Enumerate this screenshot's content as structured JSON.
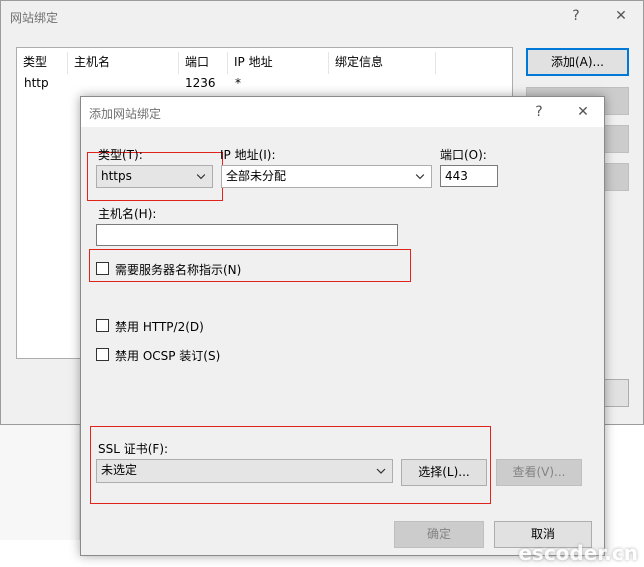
{
  "outer_window": {
    "title": "网站绑定",
    "help": "?",
    "close": "✕",
    "columns": [
      "类型",
      "主机名",
      "端口",
      "IP 地址",
      "绑定信息"
    ],
    "rows": [
      {
        "type": "http",
        "host": "",
        "port": "1236",
        "ip": "*",
        "info": ""
      }
    ],
    "buttons": {
      "add": "添加(A)..."
    }
  },
  "dialog": {
    "title": "添加网站绑定",
    "help": "?",
    "close": "✕",
    "type_label": "类型(T):",
    "type_value": "https",
    "ip_label": "IP 地址(I):",
    "ip_value": "全部未分配",
    "port_label": "端口(O):",
    "port_value": "443",
    "host_label": "主机名(H):",
    "host_value": "",
    "sni_label": "需要服务器名称指示(N)",
    "http2_label": "禁用 HTTP/2(D)",
    "ocsp_label": "禁用 OCSP 装订(S)",
    "ssl_label": "SSL 证书(F):",
    "ssl_value": "未选定",
    "select_button": "选择(L)...",
    "view_button": "查看(V)...",
    "ok_button": "确定",
    "cancel_button": "取消"
  },
  "watermark": "escoder.cn",
  "colors": {
    "highlight": "#e0241b",
    "focus": "#0078d7"
  }
}
